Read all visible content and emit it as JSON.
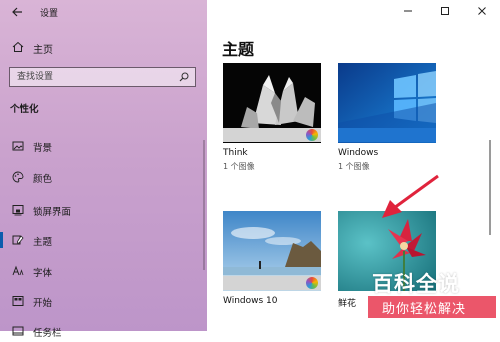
{
  "window": {
    "app_title": "设置"
  },
  "sidebar": {
    "home_label": "主页",
    "search_placeholder": "查找设置",
    "section_title": "个性化",
    "items": [
      {
        "label": "背景",
        "icon": "image-icon"
      },
      {
        "label": "颜色",
        "icon": "palette-icon"
      },
      {
        "label": "锁屏界面",
        "icon": "lock-screen-icon"
      },
      {
        "label": "主题",
        "icon": "brush-icon",
        "active": true
      },
      {
        "label": "字体",
        "icon": "font-icon"
      },
      {
        "label": "开始",
        "icon": "start-icon"
      },
      {
        "label": "任务栏",
        "icon": "taskbar-icon"
      }
    ]
  },
  "main": {
    "title": "主题",
    "themes": [
      {
        "name": "Think",
        "count": "1 个图像"
      },
      {
        "name": "Windows",
        "count": "1 个图像"
      },
      {
        "name": "Windows 10",
        "count": ""
      },
      {
        "name": "鲜花",
        "count": ""
      }
    ]
  },
  "watermark": {
    "line1": "百科全说",
    "line2": "助你轻松解决"
  },
  "colors": {
    "accent": "#0b5cad",
    "sidebar_bg": "#c9a3cc",
    "watermark_red": "#e83850"
  }
}
